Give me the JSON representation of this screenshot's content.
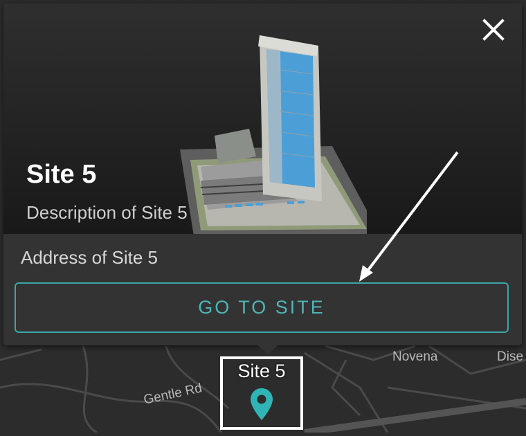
{
  "site": {
    "title": "Site 5",
    "description": "Description of Site 5",
    "address": "Address of Site 5",
    "button_label": "GO TO SITE"
  },
  "map": {
    "labels": {
      "novena": "Novena",
      "dise": "Dise",
      "gentle_rd": "Gentle Rd"
    },
    "marker_label": "Site 5"
  },
  "icons": {
    "close": "close-icon",
    "pin": "map-pin-icon"
  },
  "colors": {
    "accent": "#3aa7a7",
    "popup_bg": "#333333",
    "map_bg": "#2c2c2c",
    "pin": "#2fb5b5"
  }
}
